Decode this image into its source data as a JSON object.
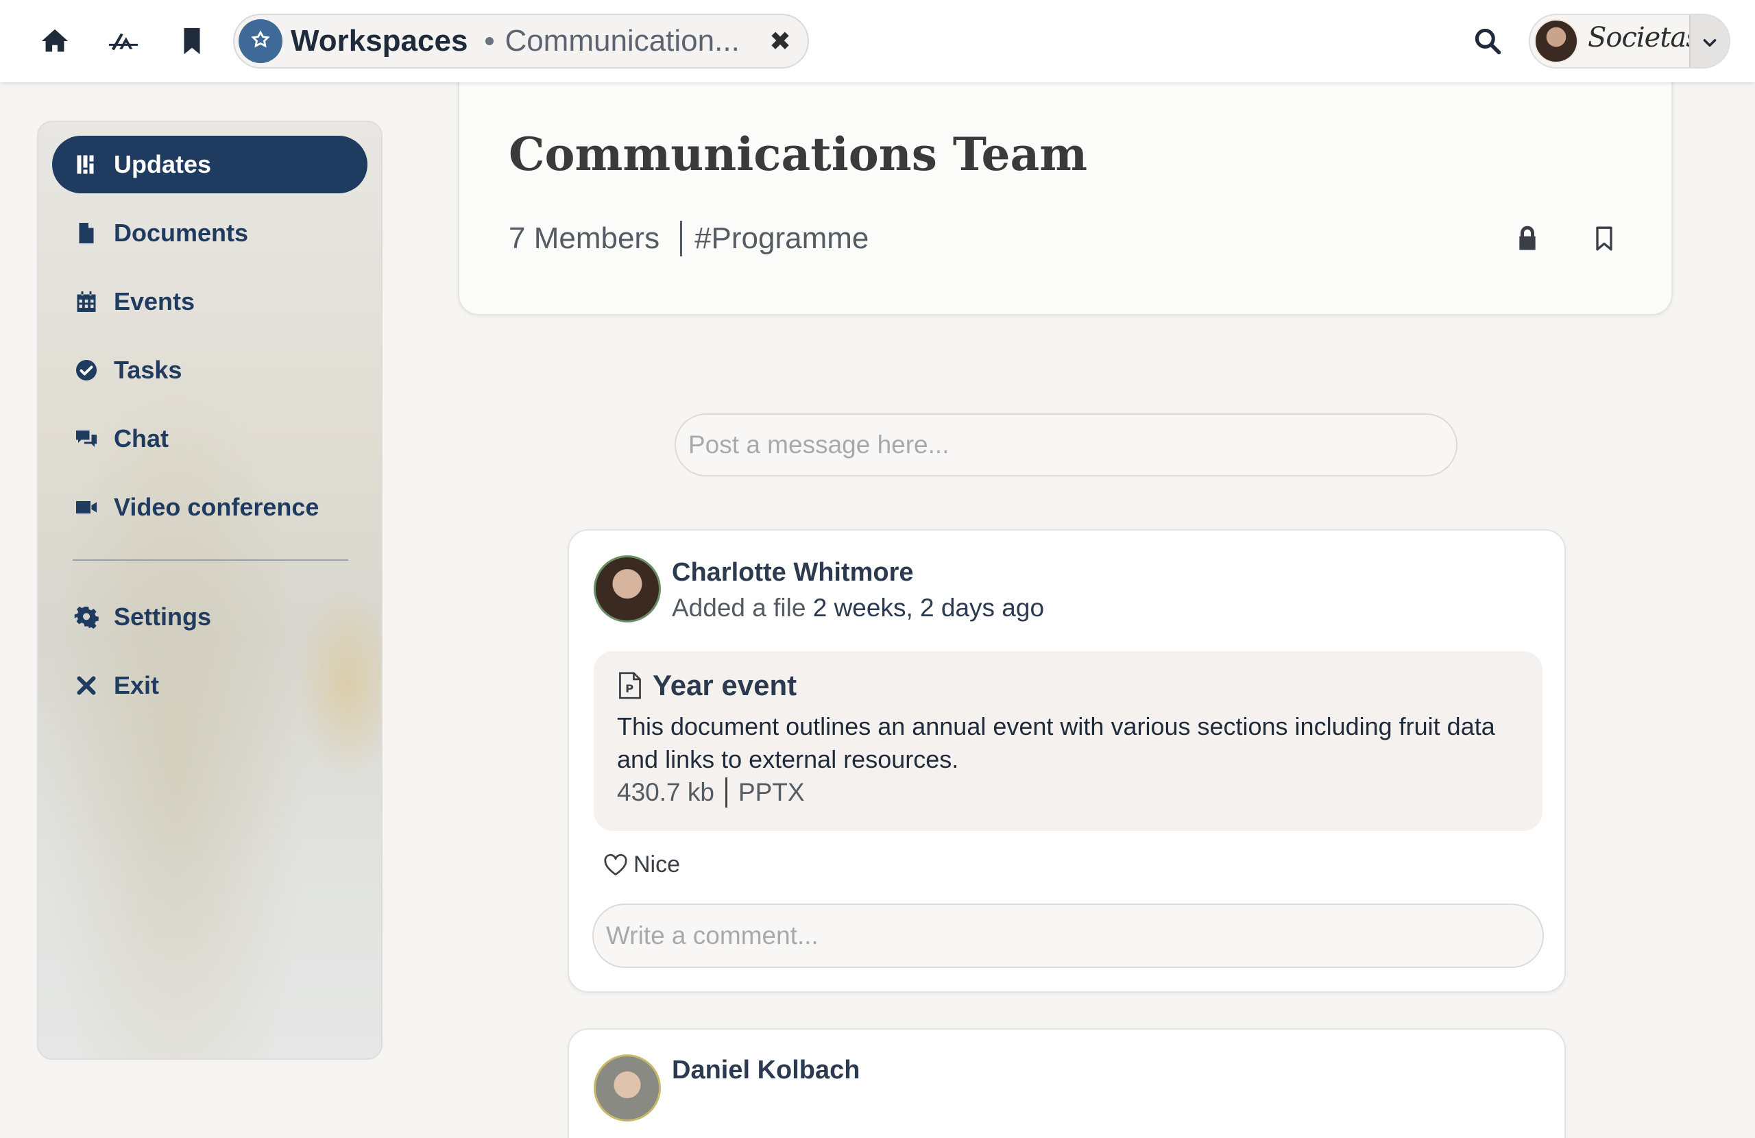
{
  "topbar": {
    "home_icon": "home-icon",
    "apps_icon": "apps-icon",
    "bookmarks_icon": "bookmark-icon",
    "workspace": {
      "title": "Workspaces",
      "subtitle": "Communication...",
      "close_glyph": "✖"
    },
    "search_icon": "search-icon",
    "account": {
      "brand": "Societas",
      "dropdown_icon": "chevron-down-icon"
    }
  },
  "sidebar": {
    "items": [
      {
        "label": "Updates",
        "icon": "updates-icon",
        "active": true
      },
      {
        "label": "Documents",
        "icon": "document-icon",
        "active": false
      },
      {
        "label": "Events",
        "icon": "calendar-icon",
        "active": false
      },
      {
        "label": "Tasks",
        "icon": "check-circle-icon",
        "active": false
      },
      {
        "label": "Chat",
        "icon": "chat-icon",
        "active": false
      },
      {
        "label": "Video conference",
        "icon": "video-icon",
        "active": false
      },
      {
        "label": "Settings",
        "icon": "gear-icon",
        "active": false
      },
      {
        "label": "Exit",
        "icon": "close-icon",
        "active": false
      }
    ]
  },
  "team": {
    "title": "Communications Team",
    "members": "7 Members",
    "tag": "#Programme",
    "lock_icon": "lock-icon",
    "bookmark_icon": "bookmark-outline-icon"
  },
  "composer": {
    "placeholder": "Post a message here..."
  },
  "feed": [
    {
      "author": "Charlotte Whitmore",
      "action": "Added a file",
      "time": "2 weeks, 2 days ago",
      "file": {
        "title": "Year event",
        "description": "This document outlines an annual event with various sections including fruit data and links to external resources.",
        "size": "430.7 kb",
        "type": "PPTX",
        "icon": "powerpoint-file-icon"
      },
      "like_label": "Nice",
      "comment_placeholder": "Write a comment..."
    },
    {
      "author": "Daniel Kolbach"
    }
  ],
  "colors": {
    "primary": "#1f3b60",
    "page_bg": "#f7f5f3",
    "workspace_logo": "#3f6a97"
  }
}
